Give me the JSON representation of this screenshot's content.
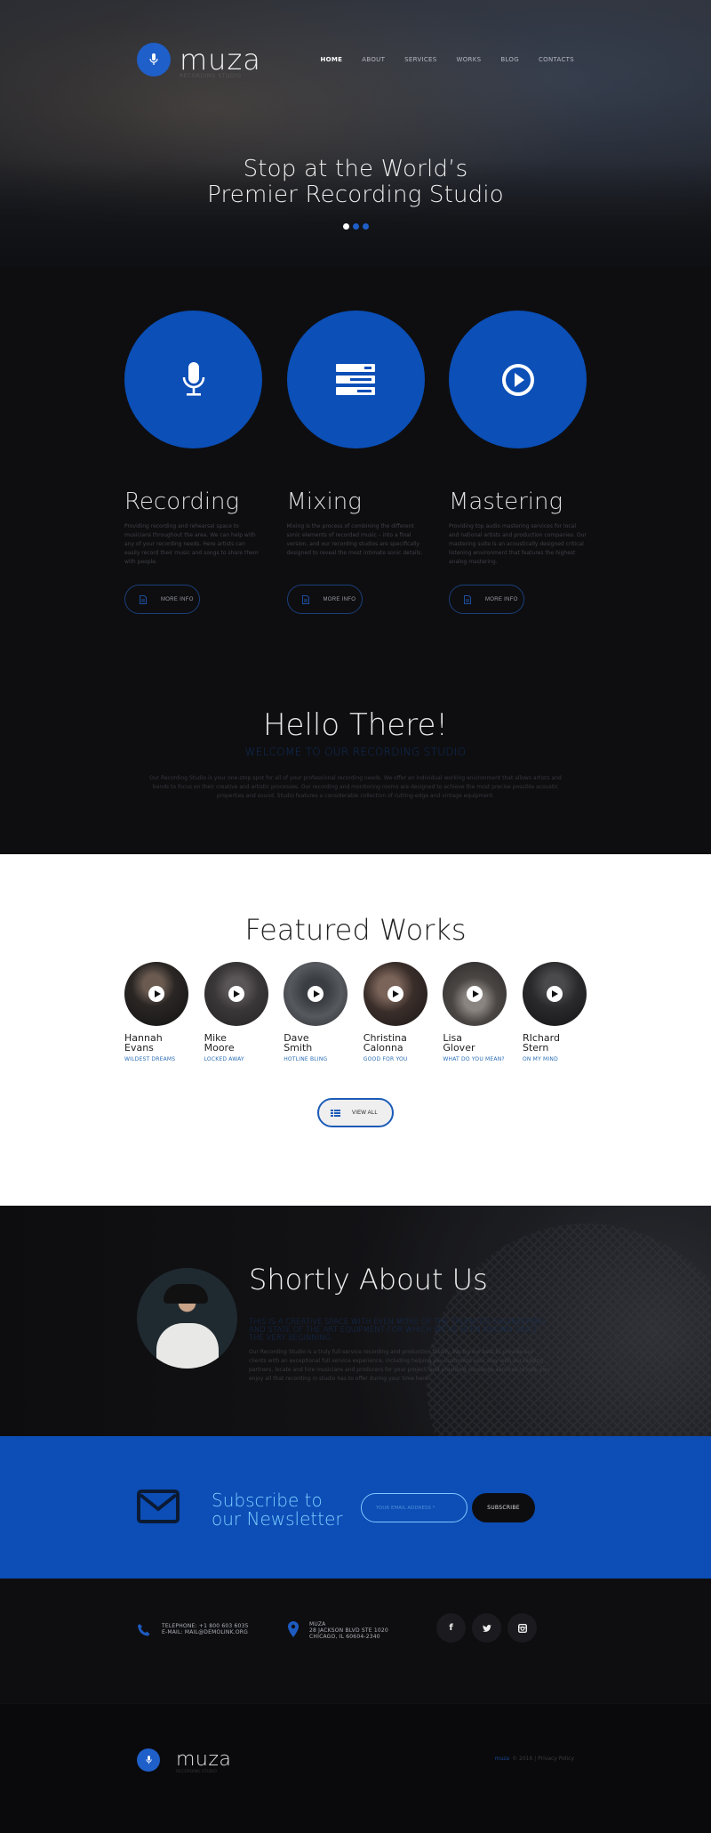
{
  "brand": {
    "name": "muza",
    "tagline": "RECORDING STUDIO",
    "accent": "#0b4fb7"
  },
  "nav": [
    {
      "label": "HOME",
      "active": true
    },
    {
      "label": "ABOUT"
    },
    {
      "label": "SERVICES"
    },
    {
      "label": "WORKS"
    },
    {
      "label": "BLOG"
    },
    {
      "label": "CONTACTS"
    }
  ],
  "hero": {
    "line1": "Stop at the World’s",
    "line2": "Premier Recording Studio",
    "slides": 3,
    "active_slide": 1
  },
  "services": [
    {
      "icon": "microphone-icon",
      "title": "Recording",
      "text": "Providing recording and rehearsal space to musicians throughout the area. We can help with any of your recording needs. Here artists can easily record their music and songs to share them with people.",
      "button": "MORE INFO"
    },
    {
      "icon": "mixer-icon",
      "title": "Mixing",
      "text": "Mixing is the process of combining the different sonic elements of recorded music – into a final version, and our recording studios are specifically designed to reveal the most intimate sonic details.",
      "button": "MORE INFO"
    },
    {
      "icon": "play-circle-icon",
      "title": "Mastering",
      "text": "Providing top audio mastering services for local and national artists and production companies. Our mastering suite is an acoustically designed critical listening environment that features the highest analog mastering.",
      "button": "MORE INFO"
    }
  ],
  "hello": {
    "title": "Hello There!",
    "subtitle": "WELCOME TO OUR RECORDING STUDIO",
    "text": "Our Recording Studio is your one-stop spot for all of your professional recording needs. We offer an individual working environment that allows artists and bands to focus on their creative and artistic processes. Our recording and monitoring rooms are designed to achieve the most precise possible acoustic properties and sound. Studio features a considerable collection of cutting-edge and vintage equipment."
  },
  "featured": {
    "title": "Featured Works",
    "works": [
      {
        "first": "Hannah",
        "last": "Evans",
        "song": "WILDEST DREAMS"
      },
      {
        "first": "Mike",
        "last": "Moore",
        "song": "LOCKED AWAY"
      },
      {
        "first": "Dave",
        "last": "Smith",
        "song": "HOTLINE BLING"
      },
      {
        "first": "Christina",
        "last": "Calonna",
        "song": "GOOD FOR YOU"
      },
      {
        "first": "Lisa",
        "last": "Glover",
        "song": "WHAT DO YOU MEAN?"
      },
      {
        "first": "RIchard",
        "last": "Stern",
        "song": "ON MY MIND"
      }
    ],
    "view_all": "VIEW ALL"
  },
  "about": {
    "title": "Shortly About Us",
    "subtitle": "THIS IS A CREATIVE SPACE WITH EVEN MORE OF THE TALENTED ENGINEERING AND STATE OF THE ART EQUIPMENT FOR WHICH WE'VE BEEN KNOWN SINCE THE VERY BEGINNING",
    "text": "Our Recording Studio is a truly full-service recording and production facility. We try our best to provide our clients with an exceptional full service experience, including helping you customize your stay with our lodging partners, locate and hire musicians and producers for your project, and providing concierge services to help you enjoy all that recording in studio has to offer during your time here."
  },
  "newsletter": {
    "title_line1": "Subscribe to",
    "title_line2": "our Newsletter",
    "placeholder": "YOUR EMAIL ADDRESS *",
    "button": "SUBSCRIBE"
  },
  "contact": {
    "phone": "TELEPHONE: +1 800 603 6035",
    "email": "E-MAIL: MAIL@DEMOLINK.ORG",
    "address": [
      "MUZA",
      "28 JACKSON BLVD STE 1020",
      "CHICAGO, IL 60604-2340"
    ],
    "socials": [
      {
        "name": "facebook",
        "glyph": "f"
      },
      {
        "name": "twitter",
        "glyph": "t"
      },
      {
        "name": "instagram",
        "glyph": "◘"
      }
    ]
  },
  "footer": {
    "brand": "muza",
    "year_text": "© 2016 | Privacy Policy",
    "tagline": "RECORDING STUDIO"
  }
}
